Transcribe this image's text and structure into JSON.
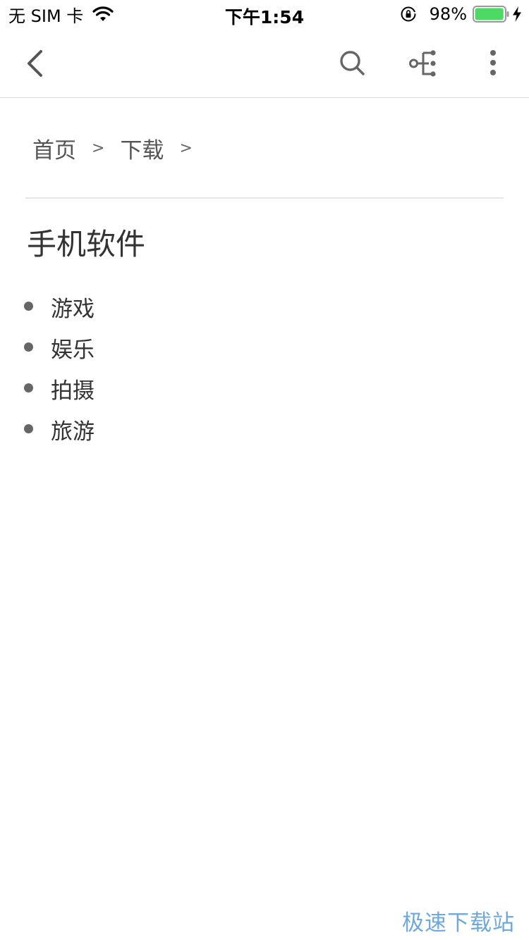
{
  "status_bar": {
    "carrier": "无 SIM 卡",
    "time": "下午1:54",
    "battery_percent": "98%",
    "battery_level": 0.98,
    "battery_color": "#4cd964"
  },
  "nav": {
    "back_icon": "chevron-left-icon",
    "search_icon": "search-icon",
    "tree_icon": "tree-structure-icon",
    "more_icon": "more-vertical-icon"
  },
  "breadcrumb": {
    "items": [
      "首页",
      "下载"
    ],
    "separator": ">"
  },
  "page": {
    "title": "手机软件"
  },
  "categories": [
    {
      "label": "游戏"
    },
    {
      "label": "娱乐"
    },
    {
      "label": "拍摄"
    },
    {
      "label": "旅游"
    }
  ],
  "watermark": "极速下载站"
}
